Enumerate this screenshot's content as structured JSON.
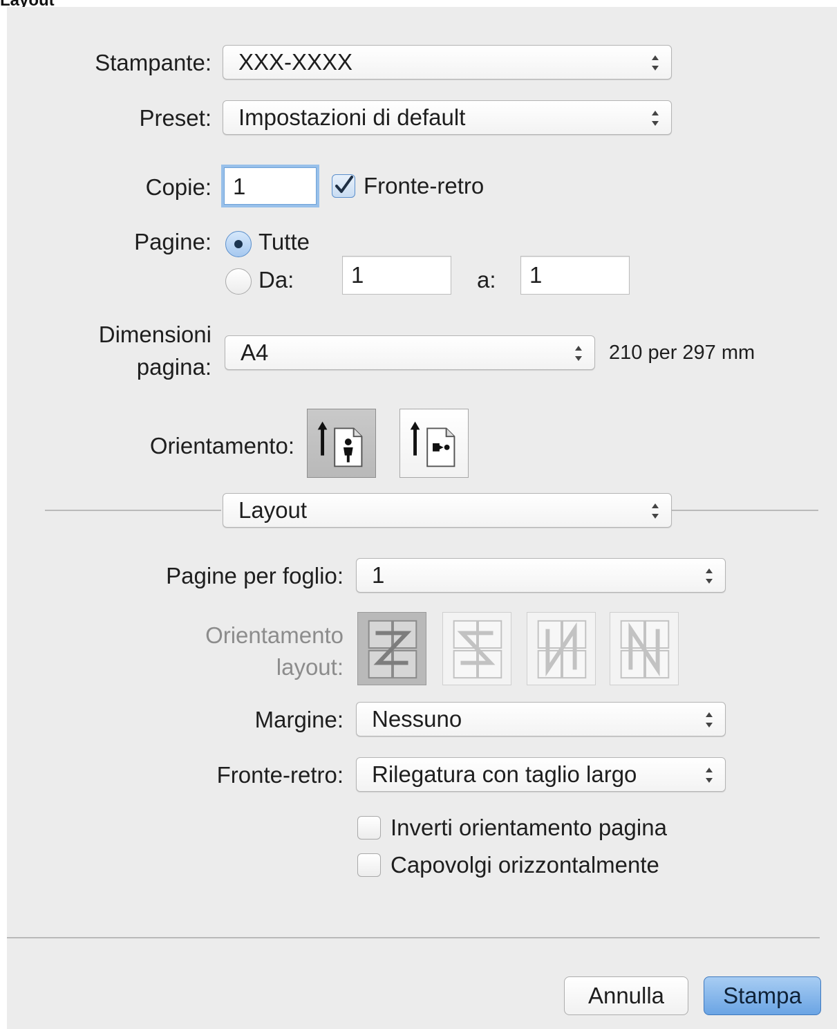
{
  "header": {
    "caption": "Layout"
  },
  "printer": {
    "label": "Stampante:",
    "value": "XXX-XXXX"
  },
  "preset": {
    "label": "Preset:",
    "value": "Impostazioni di default"
  },
  "copies": {
    "label": "Copie:",
    "value": "1",
    "duplex_label": "Fronte-retro",
    "duplex_checked": true
  },
  "pages": {
    "label": "Pagine:",
    "all_label": "Tutte",
    "from_label": "Da:",
    "from_value": "1",
    "to_label": "a:",
    "to_value": "1",
    "selected": "all"
  },
  "paper_size": {
    "label_line1": "Dimensioni",
    "label_line2": "pagina:",
    "value": "A4",
    "dimensions": "210 per 297 mm"
  },
  "orientation": {
    "label": "Orientamento:",
    "options": [
      "portrait-icon",
      "landscape-icon"
    ],
    "selected": "portrait-icon"
  },
  "section": {
    "value": "Layout"
  },
  "layout": {
    "pages_per_sheet_label": "Pagine per foglio:",
    "pages_per_sheet_value": "1",
    "direction_label_line1": "Orientamento",
    "direction_label_line2": "layout:",
    "direction_options": [
      "z-order-icon",
      "reverse-z-order-icon",
      "n-order-icon",
      "reverse-n-order-icon"
    ],
    "border_label": "Margine:",
    "border_value": "Nessuno",
    "duplex_label": "Fronte-retro:",
    "duplex_value": "Rilegatura con taglio largo",
    "reverse_orientation_label": "Inverti orientamento pagina",
    "flip_horizontal_label": "Capovolgi orizzontalmente"
  },
  "footer": {
    "cancel_label": "Annulla",
    "print_label": "Stampa"
  },
  "colors": {
    "dialog_bg": "#ececec",
    "primary_button": "#6aa4e4",
    "focus_ring": "#98c0ea"
  }
}
